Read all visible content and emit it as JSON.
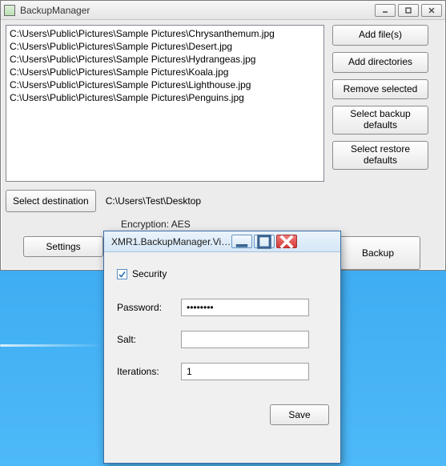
{
  "main": {
    "title": "BackupManager",
    "files": [
      "C:\\Users\\Public\\Pictures\\Sample Pictures\\Chrysanthemum.jpg",
      "C:\\Users\\Public\\Pictures\\Sample Pictures\\Desert.jpg",
      "C:\\Users\\Public\\Pictures\\Sample Pictures\\Hydrangeas.jpg",
      "C:\\Users\\Public\\Pictures\\Sample Pictures\\Koala.jpg",
      "C:\\Users\\Public\\Pictures\\Sample Pictures\\Lighthouse.jpg",
      "C:\\Users\\Public\\Pictures\\Sample Pictures\\Penguins.jpg"
    ],
    "side_buttons": {
      "add_files": "Add file(s)",
      "add_dirs": "Add directories",
      "remove_selected": "Remove selected",
      "select_backup_defaults": "Select backup\ndefaults",
      "select_restore_defaults": "Select restore\ndefaults"
    },
    "select_destination": "Select destination",
    "destination_path": "C:\\Users\\Test\\Desktop",
    "encryption_label": "Encryption: AES",
    "settings": "Settings",
    "backup": "Backup"
  },
  "dialog": {
    "title": "XMR1.BackupManager.View...",
    "security_checkbox_label": "Security",
    "security_checked": true,
    "password_label": "Password:",
    "password_value": "••••••••",
    "salt_label": "Salt:",
    "salt_value": "",
    "iterations_label": "Iterations:",
    "iterations_value": "1",
    "save": "Save"
  }
}
